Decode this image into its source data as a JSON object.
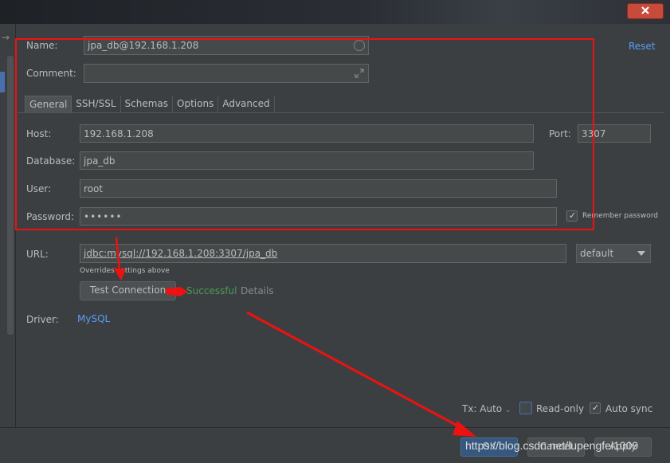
{
  "dialog": {
    "reset_label": "Reset",
    "name_label": "Name:",
    "name_value": "jpa_db@192.168.1.208",
    "comment_label": "Comment:",
    "comment_value": ""
  },
  "tabs": [
    "General",
    "SSH/SSL",
    "Schemas",
    "Options",
    "Advanced"
  ],
  "general": {
    "host_label": "Host:",
    "host_value": "192.168.1.208",
    "port_label": "Port:",
    "port_value": "3307",
    "database_label": "Database:",
    "database_value": "jpa_db",
    "user_label": "User:",
    "user_value": "root",
    "password_label": "Password:",
    "password_value": "••••••",
    "remember_password_label": "Remember password",
    "remember_password_checked": true,
    "url_label": "URL:",
    "url_value": "jdbc:mysql://192.168.1.208:3307/jpa_db",
    "url_mode": "default",
    "overrides_hint": "Overrides settings above",
    "test_connection_label": "Test Connection",
    "test_status": "Successful",
    "details_label": "Details",
    "driver_label": "Driver:",
    "driver_value": "MySQL"
  },
  "footer": {
    "tx_label": "Tx: Auto",
    "readonly_label": "Read-only",
    "readonly_checked": false,
    "autosync_label": "Auto sync",
    "autosync_checked": true,
    "ok_label": "OK",
    "cancel_label": "Cancel",
    "apply_label": "Apply"
  },
  "watermark": "https://blog.csdn.net/lupengfei1009",
  "colors": {
    "background": "#3c3f41",
    "field_bg": "#45494a",
    "accent_link": "#589df6",
    "success": "#499c54",
    "annotation_red": "#ee1111"
  }
}
